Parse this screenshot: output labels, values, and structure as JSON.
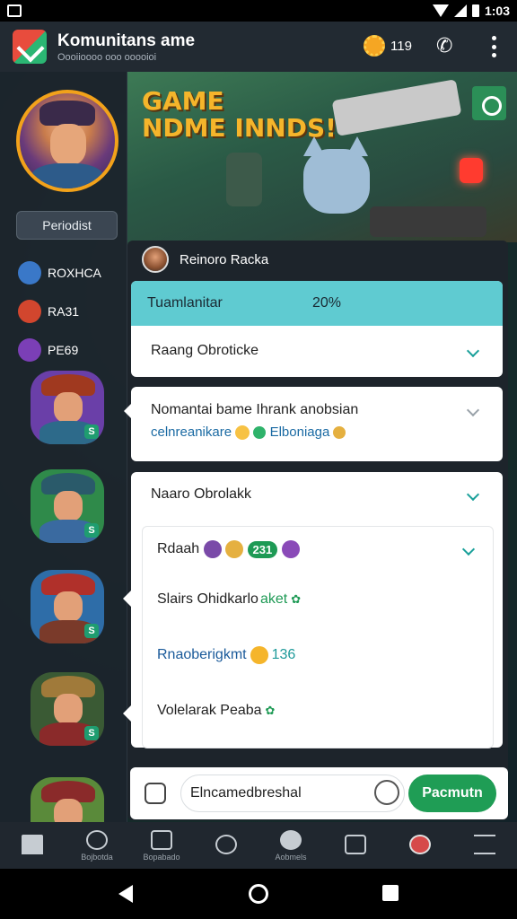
{
  "topbar": {
    "title": "Komunitans ame",
    "subtitle": "Oooiioooo ooo ooooioi",
    "coins": "119"
  },
  "banner": {
    "title_line1": "GAME",
    "title_line2": "NDME INNDS!"
  },
  "sidebar": {
    "button_label": "Periodist",
    "items": [
      {
        "label": "ROXHCA",
        "color": "#3a78c8"
      },
      {
        "label": "RA31",
        "color": "#d2462e"
      },
      {
        "label": "PE69",
        "color": "#7b3fb6"
      }
    ],
    "char_badge": "S"
  },
  "panel": {
    "header": "Reinoro Racka",
    "card1": {
      "accent_label": "Tuamlanitar",
      "accent_value": "20%",
      "row_label": "Raang Obroticke"
    },
    "card2": {
      "line1": "Nomantai bame Ihrank anobsian",
      "line2": "celnreanikare",
      "line2_tail": "Elboniaga"
    },
    "card3": {
      "title": "Naaro Obrolakk",
      "sub": {
        "row1_label": "Rdaah",
        "row1_pill": "231",
        "row2_label": "Slairs Ohidkarlo",
        "row2_accent": "aket",
        "row3_label": "Rnaoberigkmt",
        "row3_value": "136",
        "row4_label": "Volelarak Peaba"
      }
    }
  },
  "composer": {
    "input_value": "Elncamedbreshal",
    "send_label": "Pacmutn"
  },
  "tabbar": {
    "tabs": [
      {
        "label": "",
        "icon": "home-icon"
      },
      {
        "label": "Bojbotda",
        "icon": "profile-icon"
      },
      {
        "label": "Bopabado",
        "icon": "friends-icon"
      },
      {
        "label": "",
        "icon": "search-icon"
      },
      {
        "label": "Aobmels",
        "icon": "emote-icon"
      },
      {
        "label": "",
        "icon": "grid-icon"
      },
      {
        "label": "",
        "icon": "game-icon"
      },
      {
        "label": "",
        "icon": "menu-icon"
      }
    ]
  }
}
